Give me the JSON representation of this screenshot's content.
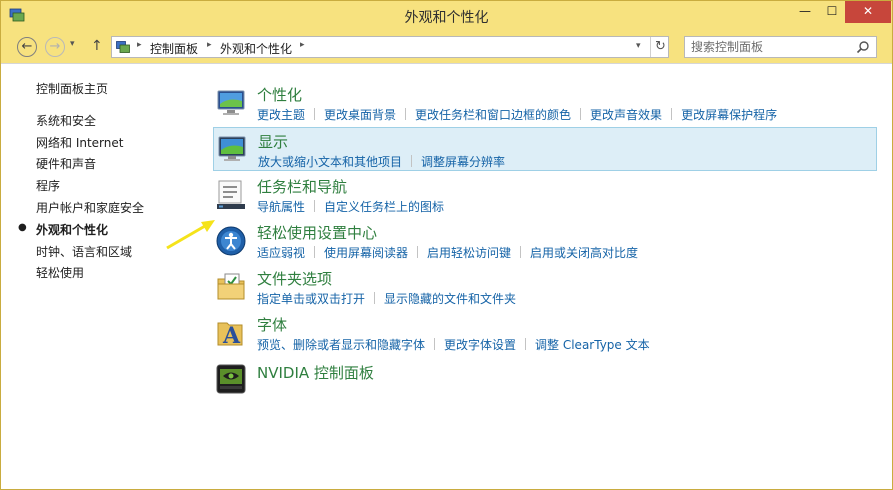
{
  "window": {
    "title": "外观和个性化",
    "min_glyph": "—",
    "max_glyph": "☐",
    "close_glyph": "✕"
  },
  "nav": {
    "back_glyph": "←",
    "forward_glyph": "→",
    "dropdown_glyph": "▾",
    "up_glyph": "↑",
    "breadcrumb": [
      "控制面板",
      "外观和个性化"
    ],
    "breadcrumb_sep": "▸",
    "refresh_glyph": "↻",
    "search_placeholder": "搜索控制面板"
  },
  "sidebar": {
    "home": "控制面板主页",
    "active_bullet": "●",
    "items": [
      "系统和安全",
      "网络和 Internet",
      "硬件和声音",
      "程序",
      "用户帐户和家庭安全",
      "外观和个性化",
      "时钟、语言和区域",
      "轻松使用"
    ],
    "active_index": 5
  },
  "categories": [
    {
      "title": "个性化",
      "icon": "personalization-icon",
      "links": [
        "更改主题",
        "更改桌面背景",
        "更改任务栏和窗口边框的颜色",
        "更改声音效果",
        "更改屏幕保护程序"
      ]
    },
    {
      "title": "显示",
      "icon": "display-icon",
      "highlighted": true,
      "links": [
        "放大或缩小文本和其他项目",
        "调整屏幕分辨率"
      ]
    },
    {
      "title": "任务栏和导航",
      "icon": "taskbar-icon",
      "links": [
        "导航属性",
        "自定义任务栏上的图标"
      ]
    },
    {
      "title": "轻松使用设置中心",
      "icon": "ease-of-access-icon",
      "links": [
        "适应弱视",
        "使用屏幕阅读器",
        "启用轻松访问键",
        "启用或关闭高对比度"
      ]
    },
    {
      "title": "文件夹选项",
      "icon": "folder-options-icon",
      "links": [
        "指定单击或双击打开",
        "显示隐藏的文件和文件夹"
      ]
    },
    {
      "title": "字体",
      "icon": "fonts-icon",
      "links": [
        "预览、删除或者显示和隐藏字体",
        "更改字体设置",
        "调整 ClearType 文本"
      ]
    },
    {
      "title": "NVIDIA 控制面板",
      "icon": "nvidia-icon",
      "links": []
    }
  ],
  "colors": {
    "titlebar": "#f7e27f",
    "link": "#1563a7",
    "category_title": "#2f7f3f",
    "highlight": "#ddeef7",
    "annotation_arrow": "#f5e31a"
  }
}
